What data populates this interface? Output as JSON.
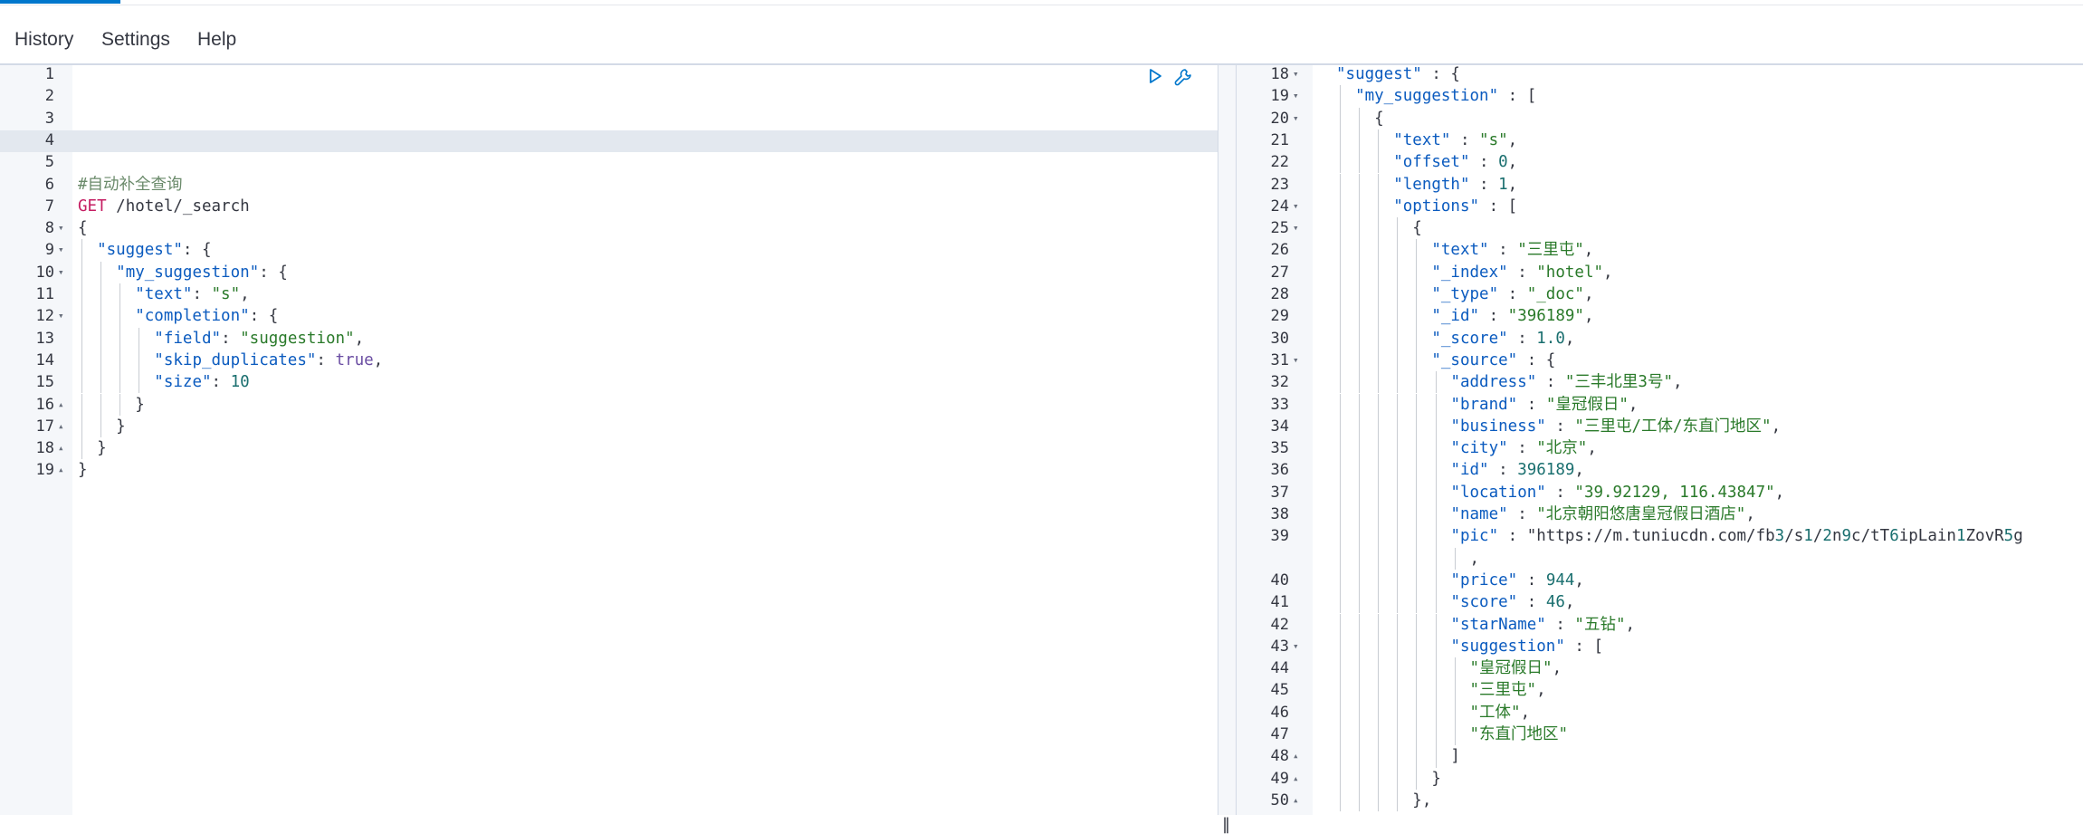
{
  "menu": {
    "items": [
      {
        "label": "History"
      },
      {
        "label": "Settings"
      },
      {
        "label": "Help"
      }
    ]
  },
  "request_editor": {
    "lines": [
      {
        "n": "1",
        "text": ""
      },
      {
        "n": "2",
        "text": ""
      },
      {
        "n": "3",
        "text": ""
      },
      {
        "n": "4",
        "text": ""
      },
      {
        "n": "5",
        "text": ""
      },
      {
        "n": "6",
        "text": "#自动补全查询"
      },
      {
        "n": "7",
        "text": "GET /hotel/_search"
      },
      {
        "n": "8",
        "text": "{"
      },
      {
        "n": "9",
        "text": "  \"suggest\": {"
      },
      {
        "n": "10",
        "text": "    \"my_suggestion\": {"
      },
      {
        "n": "11",
        "text": "      \"text\": \"s\","
      },
      {
        "n": "12",
        "text": "      \"completion\": {"
      },
      {
        "n": "13",
        "text": "        \"field\": \"suggestion\","
      },
      {
        "n": "14",
        "text": "        \"skip_duplicates\": true,"
      },
      {
        "n": "15",
        "text": "        \"size\": 10"
      },
      {
        "n": "16",
        "text": "      }"
      },
      {
        "n": "17",
        "text": "    }"
      },
      {
        "n": "18",
        "text": "  }"
      },
      {
        "n": "19",
        "text": "}"
      }
    ],
    "active_line": "4",
    "method": "GET",
    "path": "/hotel/_search"
  },
  "response_editor": {
    "lines": [
      {
        "n": "18",
        "text": "\"suggest\" : {"
      },
      {
        "n": "19",
        "text": "  \"my_suggestion\" : ["
      },
      {
        "n": "20",
        "text": "    {"
      },
      {
        "n": "21",
        "text": "      \"text\" : \"s\","
      },
      {
        "n": "22",
        "text": "      \"offset\" : 0,"
      },
      {
        "n": "23",
        "text": "      \"length\" : 1,"
      },
      {
        "n": "24",
        "text": "      \"options\" : ["
      },
      {
        "n": "25",
        "text": "        {"
      },
      {
        "n": "26",
        "text": "          \"text\" : \"三里屯\","
      },
      {
        "n": "27",
        "text": "          \"_index\" : \"hotel\","
      },
      {
        "n": "28",
        "text": "          \"_type\" : \"_doc\","
      },
      {
        "n": "29",
        "text": "          \"_id\" : \"396189\","
      },
      {
        "n": "30",
        "text": "          \"_score\" : 1.0,"
      },
      {
        "n": "31",
        "text": "          \"_source\" : {"
      },
      {
        "n": "32",
        "text": "            \"address\" : \"三丰北里3号\","
      },
      {
        "n": "33",
        "text": "            \"brand\" : \"皇冠假日\","
      },
      {
        "n": "34",
        "text": "            \"business\" : \"三里屯/工体/东直门地区\","
      },
      {
        "n": "35",
        "text": "            \"city\" : \"北京\","
      },
      {
        "n": "36",
        "text": "            \"id\" : 396189,"
      },
      {
        "n": "37",
        "text": "            \"location\" : \"39.92129, 116.43847\","
      },
      {
        "n": "38",
        "text": "            \"name\" : \"北京朝阳悠唐皇冠假日酒店\","
      },
      {
        "n": "39",
        "text": "            \"pic\" : \"https://m.tuniucdn.com/fb3/s1/2n9c/tT6ipLain1ZovR5g"
      },
      {
        "n": "",
        "text": "              ,"
      },
      {
        "n": "40",
        "text": "            \"price\" : 944,"
      },
      {
        "n": "41",
        "text": "            \"score\" : 46,"
      },
      {
        "n": "42",
        "text": "            \"starName\" : \"五钻\","
      },
      {
        "n": "43",
        "text": "            \"suggestion\" : ["
      },
      {
        "n": "44",
        "text": "              \"皇冠假日\","
      },
      {
        "n": "45",
        "text": "              \"三里屯\","
      },
      {
        "n": "46",
        "text": "              \"工体\","
      },
      {
        "n": "47",
        "text": "              \"东直门地区\""
      },
      {
        "n": "48",
        "text": "            ]"
      },
      {
        "n": "49",
        "text": "          }"
      },
      {
        "n": "50",
        "text": "        },"
      }
    ]
  },
  "icons": {
    "run": "play-icon",
    "settings": "wrench-icon",
    "divider": "resize-handle-icon"
  },
  "colors": {
    "accent": "#0077cc",
    "key": "#0b5bbf",
    "string": "#2a7a2a",
    "method": "#c51d62"
  }
}
